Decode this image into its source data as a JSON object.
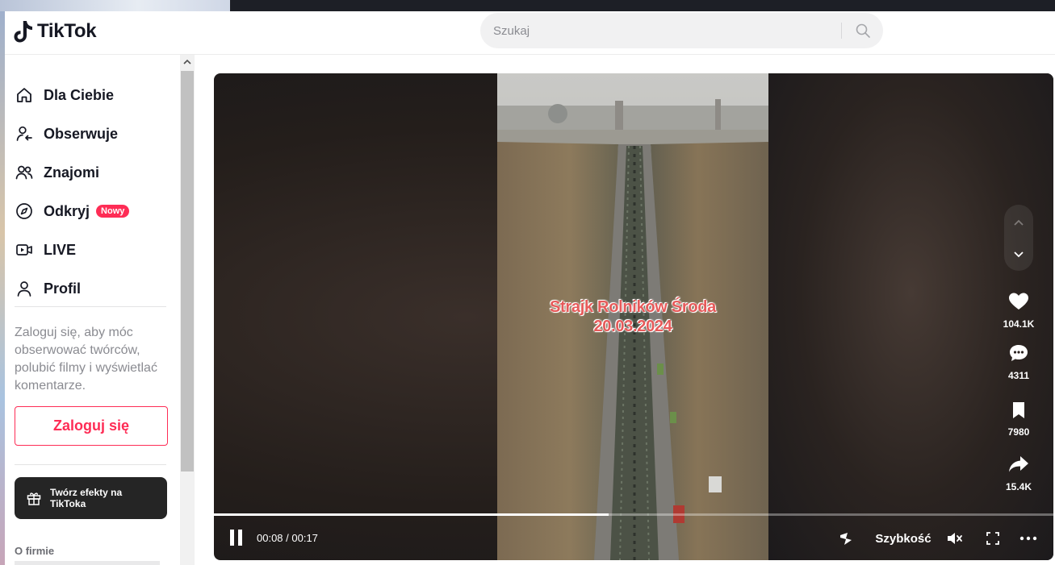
{
  "app": {
    "name": "TikTok"
  },
  "search": {
    "placeholder": "Szukaj"
  },
  "sidebar": {
    "items": [
      {
        "label": "Dla Ciebie",
        "icon": "home-icon"
      },
      {
        "label": "Obserwuje",
        "icon": "following-icon"
      },
      {
        "label": "Znajomi",
        "icon": "friends-icon"
      },
      {
        "label": "Odkryj",
        "icon": "compass-icon",
        "badge": "Nowy"
      },
      {
        "label": "LIVE",
        "icon": "live-icon"
      },
      {
        "label": "Profil",
        "icon": "profile-icon"
      }
    ],
    "login_hint": "Zaloguj się, aby móc obserwować twórców, polubić filmy i wyświetlać komentarze.",
    "login_button": "Zaloguj się",
    "effects_button": "Twórz efekty na TikToka",
    "company_label": "O firmie"
  },
  "video": {
    "overlay_line1": "Strajk Rolników  Środa",
    "overlay_line2": "20.03.2024",
    "current_time": "00:08",
    "duration": "00:17",
    "time_display": "00:08 / 00:17",
    "progress_fraction": 0.47,
    "speed_label": "Szybkość"
  },
  "actions": {
    "likes": "104.1K",
    "comments": "4311",
    "saves": "7980",
    "shares": "15.4K"
  },
  "colors": {
    "brand_red": "#fe2c55",
    "text_dark": "#161823"
  }
}
